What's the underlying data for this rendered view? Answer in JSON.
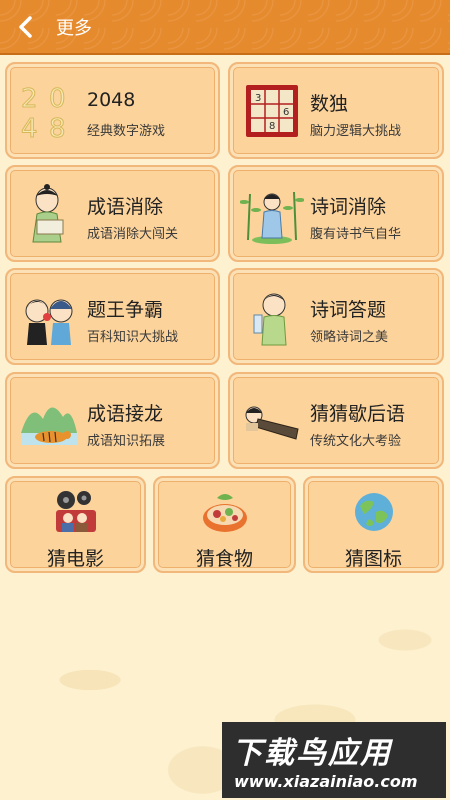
{
  "header": {
    "title": "更多"
  },
  "games": [
    {
      "title": "2048",
      "sub": "经典数字游戏",
      "icon": "2048-icon"
    },
    {
      "title": "数独",
      "sub": "脑力逻辑大挑战",
      "icon": "sudoku-icon"
    },
    {
      "title": "成语消除",
      "sub": "成语消除大闯关",
      "icon": "scholar-boy-icon"
    },
    {
      "title": "诗词消除",
      "sub": "腹有诗书气自华",
      "icon": "poet-bamboo-icon"
    },
    {
      "title": "题王争霸",
      "sub": "百科知识大挑战",
      "icon": "two-kids-icon"
    },
    {
      "title": "诗词答题",
      "sub": "领略诗词之美",
      "icon": "reading-boy-icon"
    },
    {
      "title": "成语接龙",
      "sub": "成语知识拓展",
      "icon": "tiger-landscape-icon"
    },
    {
      "title": "猜猜歇后语",
      "sub": "传统文化大考验",
      "icon": "lying-man-icon"
    }
  ],
  "small": [
    {
      "title": "猜电影",
      "icon": "film-icon"
    },
    {
      "title": "猜食物",
      "icon": "food-icon"
    },
    {
      "title": "猜图标",
      "icon": "globe-icon"
    }
  ],
  "icons": {
    "2048_digits": [
      "2",
      "0",
      "4",
      "8"
    ],
    "sudoku_digits": [
      "3",
      "6",
      "8"
    ]
  },
  "watermark": {
    "top": "下载鸟应用",
    "bottom": "www.xiazainiao.com"
  },
  "colors": {
    "header": "#e68a2e",
    "card": "#fcd39b",
    "background": "#fdf1cf"
  }
}
